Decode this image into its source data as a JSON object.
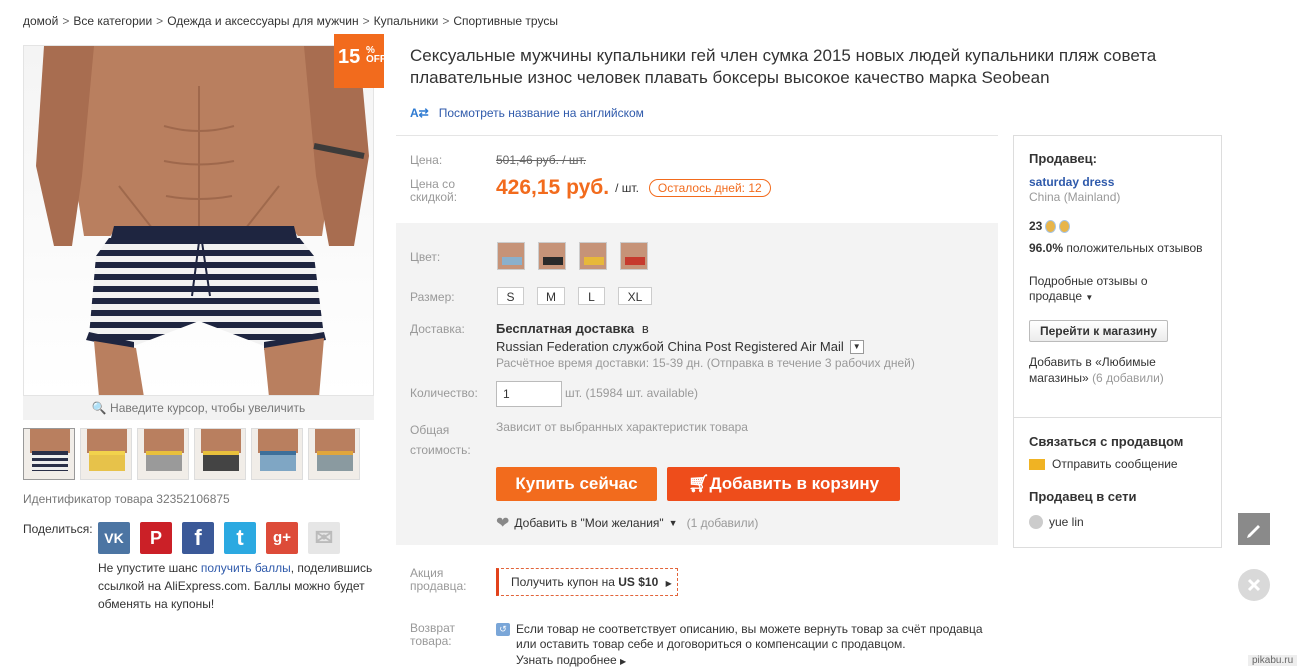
{
  "breadcrumb": [
    "домой",
    "Все категории",
    "Одежда и аксессуары для мужчин",
    "Купальники",
    "Спортивные трусы"
  ],
  "breadcrumb_sep": ">",
  "discount": {
    "number": "15",
    "percent": "%",
    "off": "OFF"
  },
  "zoom_hint": "Наведите курсор, чтобы увеличить",
  "product_id": "Идентификатор товара 32352106875",
  "share": {
    "label": "Поделиться:",
    "icons": [
      {
        "name": "vk-icon",
        "glyph": "VK",
        "color": "#4c75a3"
      },
      {
        "name": "pinterest-icon",
        "glyph": "P",
        "color": "#cb2027"
      },
      {
        "name": "facebook-icon",
        "glyph": "f",
        "color": "#3b5998"
      },
      {
        "name": "twitter-icon",
        "glyph": "t",
        "color": "#2ba9e1"
      },
      {
        "name": "googleplus-icon",
        "glyph": "g+",
        "color": "#dd4b39"
      },
      {
        "name": "email-icon",
        "glyph": "✉",
        "color": "#e6e6e6"
      }
    ],
    "note_before": "Не упустите шанс ",
    "note_link": "получить баллы",
    "note_after": ", поделившись ссылкой на AliExpress.com. Баллы можно будет обменять на купоны!"
  },
  "title": "Сексуальные мужчины купальники гей член сумка 2015 новых людей купальники пляж совета плавательные износ человек плавать боксеры высокое качество марка Seobean",
  "translate_link": "Посмотреть название на английском",
  "price": {
    "label": "Цена:",
    "original": "501,46 руб. / шт.",
    "discount_label": "Цена со скидкой:",
    "sale": "426,15 руб.",
    "unit": "/ шт.",
    "days_left": "Осталось дней: 12"
  },
  "options": {
    "color_label": "Цвет:",
    "colors": [
      "blue",
      "black",
      "yellow",
      "red"
    ],
    "size_label": "Размер:",
    "sizes": [
      "S",
      "M",
      "L",
      "XL"
    ],
    "delivery_label": "Доставка:",
    "delivery_free": "Бесплатная доставка",
    "delivery_in": "в",
    "delivery_line": "Russian Federation службой China Post Registered Air Mail",
    "delivery_time": "Расчётное время доставки: 15-39 дн. (Отправка в течение 3 рабочих дней)",
    "qty_label": "Количество:",
    "qty_value": "1",
    "qty_available": "шт. (15984 шт. available)",
    "total_label": "Общая стоимость:",
    "total_value": "Зависит от выбранных характеристик товара",
    "buy_now": "Купить сейчас",
    "add_cart": "Добавить в корзину",
    "wishlist": "Добавить в \"Мои желания\"",
    "wishlist_count": "(1 добавили)"
  },
  "promo": {
    "label": "Акция продавца:",
    "coupon": "Получить купон на",
    "coupon_amount": "US $10"
  },
  "returns": {
    "label": "Возврат товара:",
    "text": "Если товар не соответствует описанию, вы можете вернуть товар за счёт продавца или оставить товар себе и договориться о компенсации с продавцом.",
    "more": "Узнать подробнее"
  },
  "seller": {
    "heading": "Продавец:",
    "name": "saturday dress",
    "country": "China (Mainland)",
    "score": "23",
    "positive": "96.0%",
    "positive_text": "положительных отзывов",
    "detailed_reviews": "Подробные отзывы о продавце",
    "go_store": "Перейти к магазину",
    "fav_text": "Добавить в «Любимые магазины»",
    "fav_count": "(6 добавили)",
    "contact_heading": "Связаться с продавцом",
    "send_message": "Отправить сообщение",
    "online_heading": "Продавец в сети",
    "online_user": "yue lin"
  },
  "watermark": "pikabu.ru"
}
